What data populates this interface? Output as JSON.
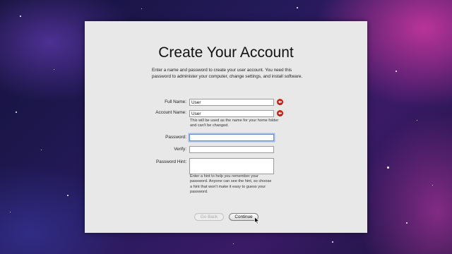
{
  "page": {
    "title": "Create Your Account",
    "intro": "Enter a name and password to create your user account. You need this password to administer your computer, change settings, and install software."
  },
  "form": {
    "full_name": {
      "label": "Full Name:",
      "value": "User"
    },
    "account_name": {
      "label": "Account Name:",
      "value": "User",
      "help": "This will be used as the name for your home folder and can't be changed."
    },
    "password": {
      "label": "Password:",
      "value": ""
    },
    "verify": {
      "label": "Verify:",
      "value": ""
    },
    "hint": {
      "label": "Password Hint:",
      "value": "",
      "help": "Enter a hint to help you remember your password. Anyone can see the hint, so choose a hint that won't make it easy to guess your password."
    }
  },
  "buttons": {
    "back": "Go Back",
    "continue": "Continue"
  },
  "colors": {
    "warning": "#d0241b",
    "focus_ring": "#9fbcef",
    "window_bg": "#e8e8e8"
  }
}
